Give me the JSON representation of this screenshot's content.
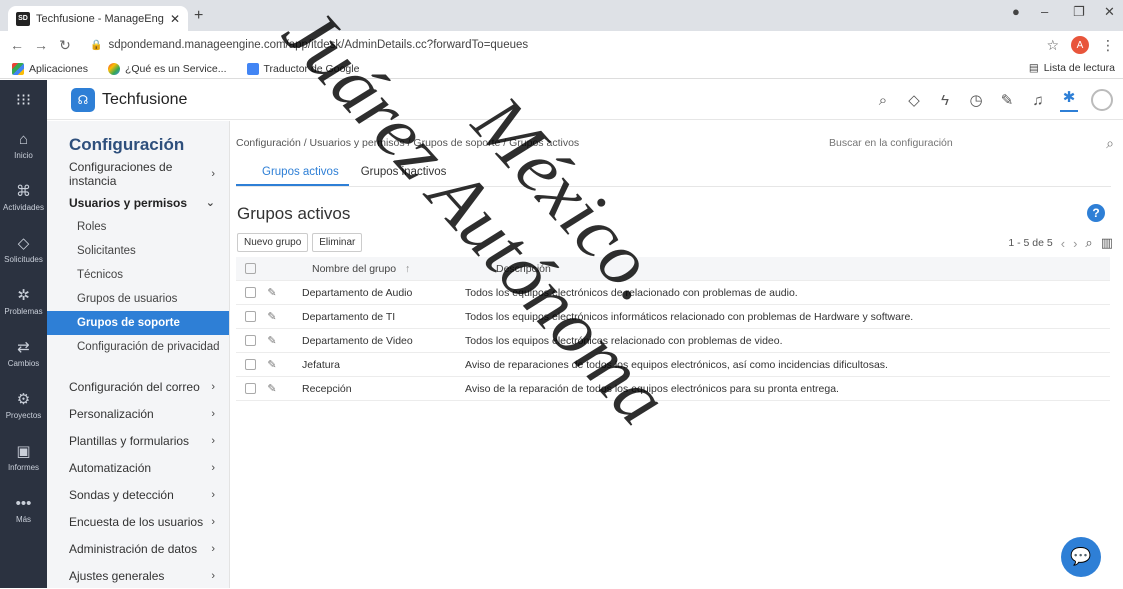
{
  "browser": {
    "tab_title": "Techfusione - ManageEngine Se",
    "tab_favicon": "SD",
    "url": "sdpondemand.manageengine.com/app/itdesk/AdminDetails.cc?forwardTo=queues",
    "profile_initial": "A",
    "bookmarks": [
      "Aplicaciones",
      "¿Qué es un Service...",
      "Traductor de Google"
    ],
    "reading_list": "Lista de lectura"
  },
  "app": {
    "brand": "Techfusione",
    "rail": [
      {
        "label": "Inicio",
        "icon": "home-icon"
      },
      {
        "label": "Actividades",
        "icon": "activities-icon"
      },
      {
        "label": "Solicitudes",
        "icon": "requests-icon"
      },
      {
        "label": "Problemas",
        "icon": "problems-icon"
      },
      {
        "label": "Cambios",
        "icon": "changes-icon"
      },
      {
        "label": "Proyectos",
        "icon": "projects-icon"
      },
      {
        "label": "Informes",
        "icon": "reports-icon"
      },
      {
        "label": "Más",
        "icon": "more-icon"
      }
    ]
  },
  "sidebar": {
    "title": "Configuración",
    "items": [
      {
        "label": "Configuraciones de instancia"
      },
      {
        "label": "Usuarios y permisos"
      },
      {
        "label": "Configuración del correo"
      },
      {
        "label": "Personalización"
      },
      {
        "label": "Plantillas y formularios"
      },
      {
        "label": "Automatización"
      },
      {
        "label": "Sondas y detección"
      },
      {
        "label": "Encuesta de los usuarios"
      },
      {
        "label": "Administración de datos"
      },
      {
        "label": "Ajustes generales"
      }
    ],
    "sub": [
      "Roles",
      "Solicitantes",
      "Técnicos",
      "Grupos de usuarios",
      "Grupos de soporte",
      "Configuración de privacidad"
    ]
  },
  "main": {
    "breadcrumb": "Configuración / Usuarios y permisos / Grupos de soporte / Grupos activos",
    "search_placeholder": "Buscar en la configuración",
    "tabs": [
      "Grupos activos",
      "Grupos inactivos"
    ],
    "title": "Grupos activos",
    "new_group": "Nuevo grupo",
    "delete": "Eliminar",
    "pagination": "1 - 5 de 5",
    "col_name": "Nombre del grupo",
    "col_desc": "Descripción",
    "rows": [
      {
        "name": "Departamento de Audio",
        "desc": "Todos los equipos electrónicos de relacionado con problemas de audio."
      },
      {
        "name": "Departamento de TI",
        "desc": "Todos los equipos electrónicos informáticos relacionado con problemas de Hardware y software."
      },
      {
        "name": "Departamento de Video",
        "desc": "Todos los equipos electrónicos relacionado con problemas de video."
      },
      {
        "name": "Jefatura",
        "desc": "Aviso de reparaciones de todos los equipos electrónicos, así como incidencias dificultosas."
      },
      {
        "name": "Recepción",
        "desc": "Aviso de la reparación de todos los equipos electrónicos para su pronta entrega."
      }
    ]
  },
  "watermark": [
    "Juárez Autónoma",
    "México."
  ],
  "colors": {
    "accent": "#2e7fd6",
    "rail": "#2b3240",
    "sidebar_title": "#2e4f7c"
  }
}
